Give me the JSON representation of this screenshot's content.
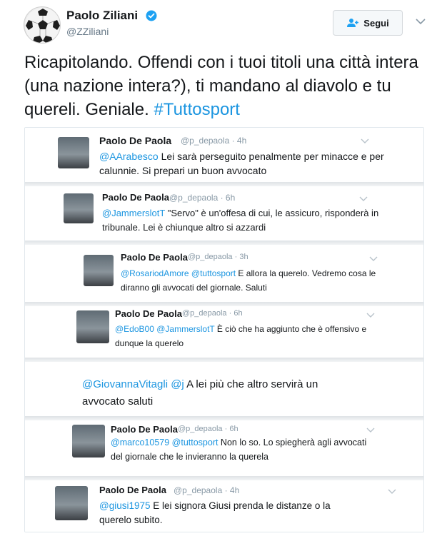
{
  "author": {
    "name": "Paolo Ziliani",
    "handle": "@ZZiliani",
    "follow_label": "Segui"
  },
  "tweet": {
    "text_before": "Ricapitolando. Offendi con i tuoi titoli una città intera (una nazione intera?), ti mandano al diavolo e tu quereli. Geniale. ",
    "hashtag": "#Tuttosport"
  },
  "embedded_tweets": [
    {
      "name": "Paolo De Paola",
      "meta": "@p_depaola · 4h",
      "mentions": "@AArabesco",
      "text": " Lei sarà perseguito penalmente per minacce e per calunnie. Si prepari un buon avvocato"
    },
    {
      "name": "Paolo De Paola",
      "meta": "@p_depaola · 6h",
      "mentions": "@JammerslotT",
      "text": " \"Servo\" è un'offesa di cui, le assicuro, risponderà in tribunale. Lei è chiunque altro si azzardi"
    },
    {
      "name": "Paolo De Paola",
      "meta": "@p_depaola · 3h",
      "mentions": "@RosariodAmore @tuttosport",
      "text": " E allora la querelo. Vedremo cosa le diranno gli avvocati del giornale. Saluti"
    },
    {
      "name": "Paolo De Paola",
      "meta": "@p_depaola · 6h",
      "mentions": "@EdoB00 @JammerslotT",
      "text": " È ciò che ha aggiunto che è offensivo e dunque la querelo"
    },
    {
      "name": "",
      "meta": "",
      "mentions": "@GiovannaVitagli @j",
      "text": " A lei più che altro servirà un avvocato saluti"
    },
    {
      "name": "Paolo De Paola",
      "meta": "@p_depaola · 6h",
      "mentions": "@marco10579 @tuttosport",
      "text": " Non lo so. Lo spiegherà agli avvocati del giornale che le invieranno la querela"
    },
    {
      "name": "Paolo De Paola",
      "meta": "@p_depaola · 4h",
      "mentions": "@giusi1975",
      "text": " E lei signora Giusi prenda le distanze o la querelo subito."
    }
  ]
}
